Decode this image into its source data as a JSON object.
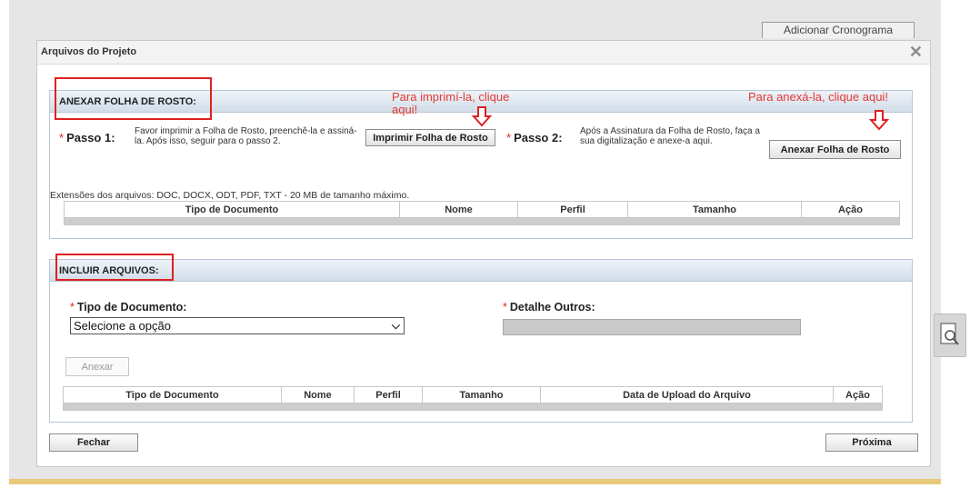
{
  "top_button": "Adicionar Cronograma",
  "modal": {
    "title": "Arquivos do Projeto",
    "close": "✕"
  },
  "annex_section": {
    "title": "ANEXAR FOLHA DE ROSTO:",
    "note_print": "Para imprimí-la, clique aqui!",
    "note_attach": "Para anexá-la, clique aqui!",
    "step1_label": "Passo 1:",
    "step1_text": "Favor imprimir a Folha de Rosto, preenchê-la e assiná-la. Após isso, seguir para o passo 2.",
    "print_button": "Imprimir Folha de Rosto",
    "step2_label": "Passo 2:",
    "step2_text": "Após a Assinatura da Folha de Rosto, faça a sua digitalização e anexe-a aqui.",
    "attach_button": "Anexar Folha de Rosto",
    "extensions_note": "Extensões dos arquivos: DOC, DOCX, ODT, PDF, TXT - 20 MB de tamanho máximo.",
    "columns": [
      "Tipo de Documento",
      "Nome",
      "Perfil",
      "Tamanho",
      "Ação"
    ]
  },
  "include_section": {
    "title": "INCLUIR ARQUIVOS:",
    "doc_type_label": "Tipo de Documento:",
    "doc_type_value": "Selecione a opção",
    "other_detail_label": "Detalhe Outros:",
    "attach_button": "Anexar",
    "columns": [
      "Tipo de Documento",
      "Nome",
      "Perfil",
      "Tamanho",
      "Data de Upload do Arquivo",
      "Ação"
    ]
  },
  "footer": {
    "close_button": "Fechar",
    "next_button": "Próxima"
  },
  "colors": {
    "annotation_red": "#e53935",
    "section_border": "#b9c8d6"
  },
  "icons": [
    "close-icon",
    "down-arrow-icon",
    "chevron-down-icon",
    "zoom-icon"
  ]
}
